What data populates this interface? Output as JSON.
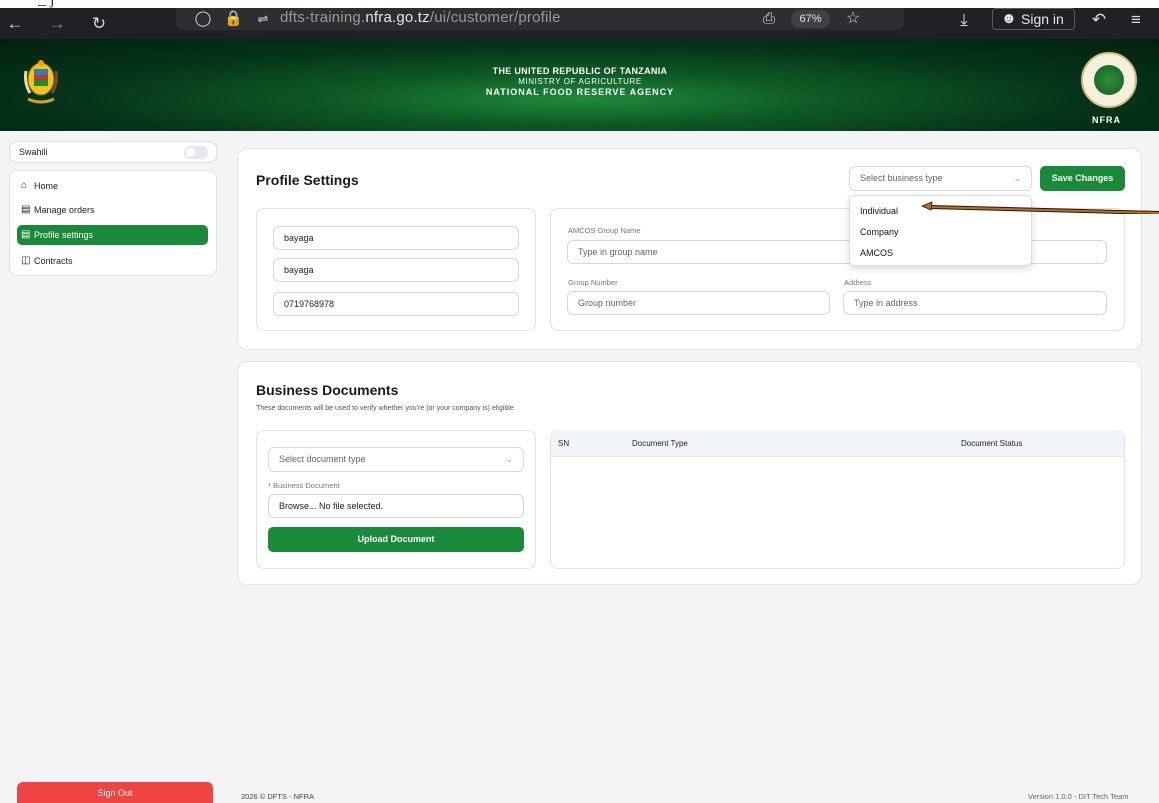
{
  "caption": "*** _ j",
  "browser": {
    "url_prefix": "dfts-training.",
    "url_domain": "nfra.go.tz",
    "url_path": "/ui/customer/profile",
    "zoom": "67%",
    "sign_in_label": "Sign in"
  },
  "banner": {
    "line1": "THE UNITED REPUBLIC OF TANZANIA",
    "line2": "MINISTRY OF AGRICULTURE",
    "line3": "NATIONAL FOOD RESERVE AGENCY",
    "logo_text": "NFRA"
  },
  "sidebar": {
    "language_label": "Swahili",
    "items": [
      {
        "label": "Home",
        "icon": "home-icon"
      },
      {
        "label": "Manage orders",
        "icon": "orders-icon"
      },
      {
        "label": "Profile settings",
        "icon": "profile-icon"
      },
      {
        "label": "Contracts",
        "icon": "contracts-icon"
      }
    ],
    "sign_out_label": "Sign Out"
  },
  "profile": {
    "title": "Profile Settings",
    "business_type_placeholder": "Select business type",
    "save_label": "Save Changes",
    "first_name": "bayaga",
    "last_name": "bayaga",
    "phone": "0719768978",
    "amcos_label": "AMCOS Group Name",
    "amcos_placeholder": "Type in group name",
    "group_number_label": "Group Number",
    "group_number_placeholder": "Group number",
    "address_label": "Address",
    "address_placeholder": "Type in address",
    "business_type_options": [
      "Individual",
      "Company",
      "AMCOS"
    ]
  },
  "documents": {
    "title": "Business Documents",
    "subtitle": "These documents will be used to verify whether you're (or your company is) eligible",
    "doc_type_placeholder": "Select document type",
    "business_doc_label": "* Business Document",
    "file_input_text": "Browse... No file selected.",
    "upload_label": "Upload Document",
    "table_headers": [
      "SN",
      "Document Type",
      "Document Status"
    ]
  },
  "footer": {
    "left": "2026 © DFTS - NFRA",
    "right": "Version 1.0.0 - DIT Tech Team"
  },
  "colors": {
    "primary_green": "#198a3a",
    "danger_red": "#ef4444",
    "arrow": "#c56a12"
  }
}
